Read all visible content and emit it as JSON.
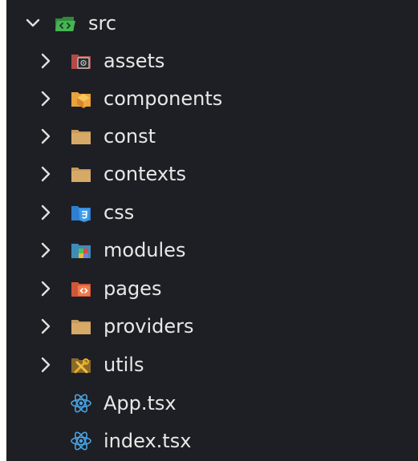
{
  "explorer": {
    "root": {
      "label": "src",
      "expanded": true,
      "icon": "folder-src-open-icon",
      "color": "#3aa54a"
    },
    "children": [
      {
        "label": "assets",
        "type": "folder",
        "icon": "folder-assets-icon",
        "color": "#c0504d"
      },
      {
        "label": "components",
        "type": "folder",
        "icon": "folder-components-icon",
        "color": "#e8a33a"
      },
      {
        "label": "const",
        "type": "folder",
        "icon": "folder-icon",
        "color": "#c69a5a"
      },
      {
        "label": "contexts",
        "type": "folder",
        "icon": "folder-icon",
        "color": "#c69a5a"
      },
      {
        "label": "css",
        "type": "folder",
        "icon": "folder-css-icon",
        "color": "#2f7fd0"
      },
      {
        "label": "modules",
        "type": "folder",
        "icon": "folder-modules-icon",
        "color": "#4a8fc0"
      },
      {
        "label": "pages",
        "type": "folder",
        "icon": "folder-pages-icon",
        "color": "#e0653a"
      },
      {
        "label": "providers",
        "type": "folder",
        "icon": "folder-icon",
        "color": "#c69a5a"
      },
      {
        "label": "utils",
        "type": "folder",
        "icon": "folder-utils-icon",
        "color": "#d9a12a"
      },
      {
        "label": "App.tsx",
        "type": "file",
        "icon": "react-icon",
        "color": "#4aa3e0"
      },
      {
        "label": "index.tsx",
        "type": "file",
        "icon": "react-icon",
        "color": "#4aa3e0"
      }
    ]
  }
}
